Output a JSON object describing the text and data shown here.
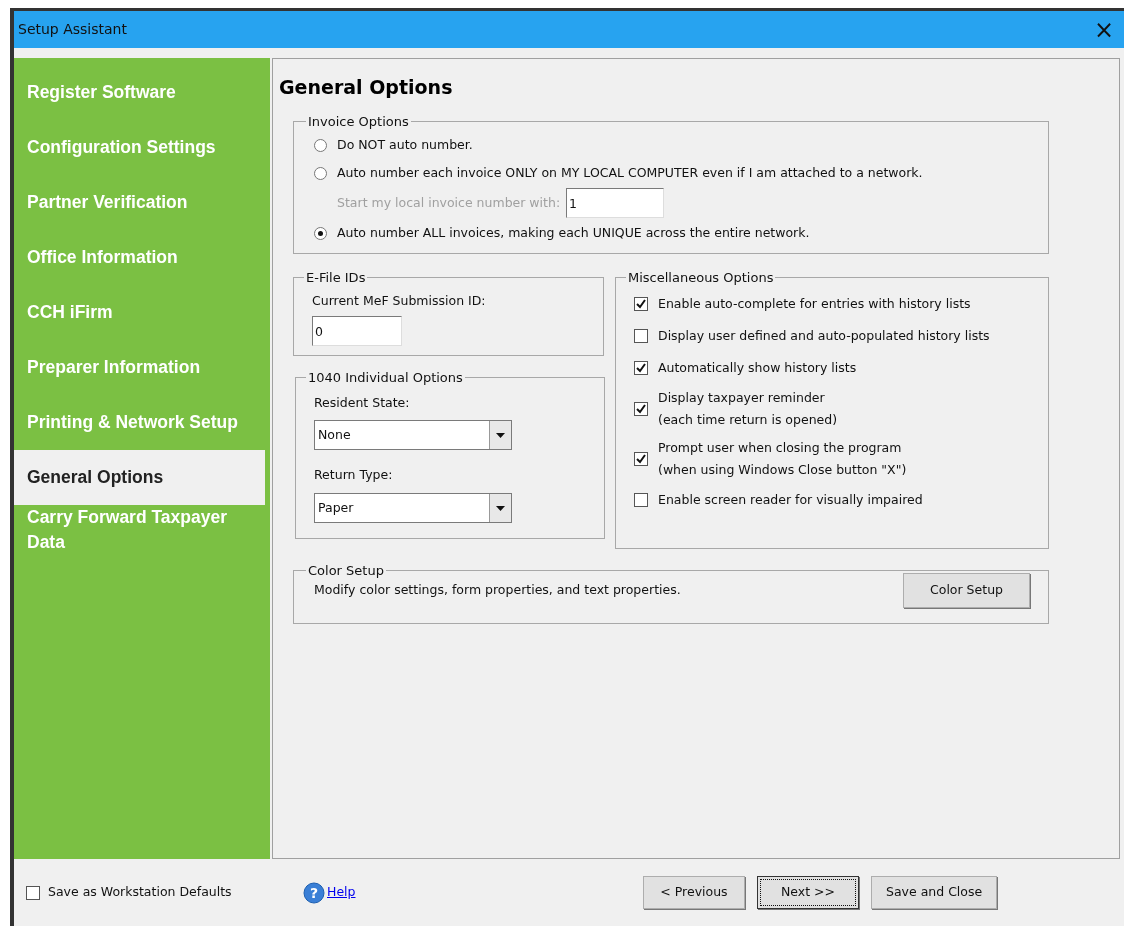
{
  "window": {
    "title": "Setup Assistant",
    "close": "×"
  },
  "sidebar": {
    "items": [
      {
        "label": "Register Software",
        "selected": false
      },
      {
        "label": "Configuration Settings",
        "selected": false
      },
      {
        "label": "Partner Verification",
        "selected": false
      },
      {
        "label": "Office Information",
        "selected": false
      },
      {
        "label": "CCH iFirm",
        "selected": false
      },
      {
        "label": "Preparer Information",
        "selected": false
      },
      {
        "label": "Printing & Network Setup",
        "selected": false
      },
      {
        "label": "General Options",
        "selected": true
      },
      {
        "label": "Carry Forward Taxpayer Data",
        "selected": false
      }
    ]
  },
  "page_title": "General Options",
  "invoice_options": {
    "legend": "Invoice Options",
    "options": [
      {
        "label": "Do NOT auto number.",
        "selected": false
      },
      {
        "label": "Auto number each invoice ONLY on MY LOCAL COMPUTER even if I am attached to a network.",
        "selected": false,
        "field": {
          "label": "Start my local invoice number with:",
          "value": "1",
          "disabled": true
        }
      },
      {
        "label": "Auto number ALL invoices, making each UNIQUE across the entire network.",
        "selected": true
      }
    ]
  },
  "efile_ids": {
    "legend": "E-File IDs",
    "label": "Current MeF Submission ID:",
    "value": "0"
  },
  "individual_1040": {
    "legend": "1040 Individual Options",
    "fields": [
      {
        "label": "Resident State:",
        "value": "None"
      },
      {
        "label": "Return Type:",
        "value": "Paper"
      }
    ]
  },
  "misc_options": {
    "legend": "Miscellaneous Options",
    "checkboxes": [
      {
        "label": "Enable auto-complete for entries with history lists",
        "checked": true
      },
      {
        "label": "Display user defined and auto-populated history lists",
        "checked": false
      },
      {
        "label": "Automatically show history lists",
        "checked": true
      },
      {
        "label": "Display taxpayer reminder",
        "note": "(each time return is opened)",
        "checked": true
      },
      {
        "label": "Prompt user when closing the program",
        "note": "(when using Windows Close button \"X\")",
        "checked": true
      },
      {
        "label": "Enable screen reader for visually impaired",
        "checked": false
      }
    ]
  },
  "color_setup": {
    "legend": "Color Setup",
    "description": "Modify color settings, form properties, and text properties.",
    "button": "Color Setup"
  },
  "footer": {
    "checkbox": {
      "label": "Save as Workstation Defaults",
      "checked": false
    },
    "help_icon": "?",
    "help": "Help",
    "buttons": [
      {
        "label": "< Previous",
        "focused": false
      },
      {
        "label": "Next >>",
        "focused": true
      },
      {
        "label": "Save and Close",
        "focused": false
      }
    ]
  }
}
